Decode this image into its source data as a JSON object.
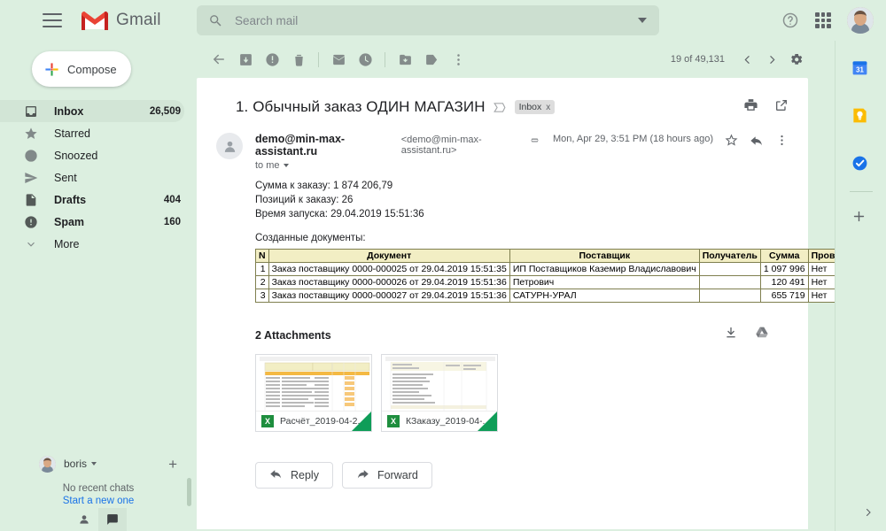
{
  "app": {
    "name": "Gmail"
  },
  "search": {
    "placeholder": "Search mail",
    "value": ""
  },
  "header": {
    "help_icon": "help-icon",
    "apps_icon": "apps-grid-icon",
    "avatar_icon": "account-avatar"
  },
  "sidebar": {
    "compose_label": "Compose",
    "items": [
      {
        "label": "Inbox",
        "count": "26,509",
        "icon": "inbox-icon",
        "selected": true
      },
      {
        "label": "Starred",
        "count": "",
        "icon": "star-icon",
        "selected": false
      },
      {
        "label": "Snoozed",
        "count": "",
        "icon": "clock-icon",
        "selected": false
      },
      {
        "label": "Sent",
        "count": "",
        "icon": "send-icon",
        "selected": false
      },
      {
        "label": "Drafts",
        "count": "404",
        "icon": "draft-icon",
        "selected": false
      },
      {
        "label": "Spam",
        "count": "160",
        "icon": "spam-icon",
        "selected": false
      },
      {
        "label": "More",
        "count": "",
        "icon": "chevron-down-icon",
        "selected": false
      }
    ]
  },
  "chat": {
    "user": "boris",
    "no_chats": "No recent chats",
    "start_link": "Start a new one",
    "add_icon": "plus-icon",
    "contacts_icon": "person-icon",
    "chat_icon": "chat-bubble-icon"
  },
  "toolbar": {
    "back_icon": "back-arrow-icon",
    "archive_icon": "archive-icon",
    "spam_icon": "report-spam-icon",
    "delete_icon": "trash-icon",
    "unread_icon": "mark-unread-icon",
    "snooze_icon": "snooze-clock-icon",
    "moveto_icon": "move-to-folder-icon",
    "label_icon": "label-tag-icon",
    "more_icon": "more-vertical-icon",
    "counter": "19 of 49,131",
    "prev_icon": "chevron-left-icon",
    "next_icon": "chevron-right-icon",
    "settings_icon": "gear-icon"
  },
  "email": {
    "subject": "1. Обычный заказ ОДИН МАГАЗИН",
    "important_icon": "important-marker-icon",
    "label_chip": "Inbox",
    "label_chip_remove": "x",
    "print_icon": "print-icon",
    "popout_icon": "open-in-new-window-icon",
    "sender_name": "demo@min-max-assistant.ru",
    "sender_email": "<demo@min-max-assistant.ru>",
    "to_line": "to me",
    "date": "Mon, Apr 29, 3:51 PM (18 hours ago)",
    "unsubscribe_icon": "attachment-clip-icon",
    "star_icon": "star-outline-icon",
    "reply_icon": "reply-arrow-icon",
    "more_icon": "more-vertical-icon",
    "body_lines": [
      "Сумма к заказу: 1 874 206,79",
      "Позиций к заказу: 26",
      "Время запуска: 29.04.2019 15:51:36"
    ],
    "table_caption": "Созданные документы:",
    "table": {
      "columns": [
        "N",
        "Документ",
        "Поставщик",
        "Получатель",
        "Сумма",
        "Проведен"
      ],
      "rows": [
        [
          "1",
          "Заказ поставщику 0000-000025 от 29.04.2019 15:51:35",
          "ИП Поставщиков Каземир Владиславович",
          "",
          "1 097 996",
          "Нет"
        ],
        [
          "2",
          "Заказ поставщику 0000-000026 от 29.04.2019 15:51:36",
          "Петрович",
          "",
          "120 491",
          "Нет"
        ],
        [
          "3",
          "Заказ поставщику 0000-000027 от 29.04.2019 15:51:36",
          "САТУРН-УРАЛ",
          "",
          "655 719",
          "Нет"
        ]
      ]
    },
    "attachments_title": "2 Attachments",
    "download_all_icon": "download-icon",
    "save_to_drive_icon": "google-drive-icon",
    "attachments": [
      {
        "name": "Расчёт_2019-04-2...",
        "type": "X"
      },
      {
        "name": "КЗаказу_2019-04-...",
        "type": "X"
      }
    ],
    "reply_label": "Reply",
    "forward_label": "Forward",
    "forward_icon": "forward-arrow-icon"
  },
  "rail": {
    "items": [
      {
        "icon": "google-calendar-icon"
      },
      {
        "icon": "google-keep-icon"
      },
      {
        "icon": "google-tasks-icon"
      }
    ],
    "add_icon": "plus-icon",
    "expand_icon": "chevron-right-icon"
  },
  "colors": {
    "background": "#dcefe0",
    "card": "#ffffff",
    "accent_blue": "#1a73e8",
    "excel_green": "#0f9d58",
    "table_header": "#f2eec4",
    "table_border": "#7f7f4f",
    "gmail_red": "#ea4335"
  }
}
